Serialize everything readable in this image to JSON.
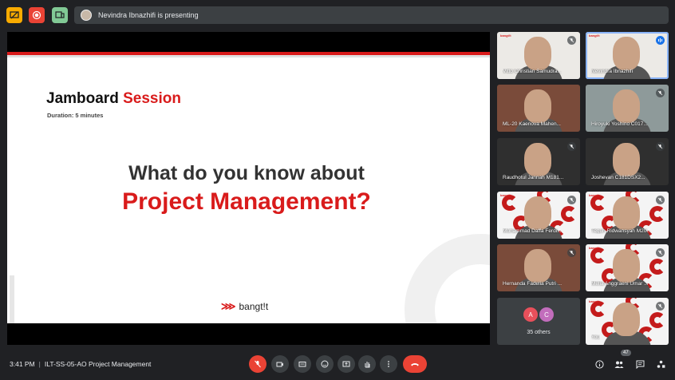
{
  "colors": {
    "bg": "#202124",
    "brand_red": "#d91b1b",
    "call_red": "#ea4335",
    "active_blue": "#1a73e8"
  },
  "topbar": {
    "presenting_text": "Nevindra Ibnazhifi is presenting",
    "icons": [
      "presentation-icon",
      "record-icon",
      "jamboard-icon"
    ]
  },
  "slide": {
    "title_black": "Jamboard",
    "title_red": "Session",
    "duration": "Duration: 5 minutes",
    "question_line1": "What do you know about",
    "question_line2": "Project Management?",
    "brand_mark": "⋙",
    "brand_text": "bangt!t"
  },
  "participants": [
    {
      "name": "Vitto Christian Samudra...",
      "muted": true,
      "bg": "white"
    },
    {
      "name": "Nevindra Ibnazhifi",
      "muted": false,
      "speaking": true,
      "bg": "white"
    },
    {
      "name": "ML-20 Kaenova Mahen...",
      "muted": false,
      "bg": "warm"
    },
    {
      "name": "Hiroyuki Yoshino C017...",
      "muted": true,
      "bg": "grey"
    },
    {
      "name": "Raudhotul Jannah M181...",
      "muted": true,
      "bg": "dark"
    },
    {
      "name": "Joshevan C181DSX2...",
      "muted": true,
      "bg": "dark"
    },
    {
      "name": "Muhammad Daffa Ferdi...",
      "muted": true,
      "bg": "pattern"
    },
    {
      "name": "Teguh Ridwansyah M20...",
      "muted": true,
      "bg": "pattern"
    },
    {
      "name": "Hernanda Fadelia Putri ...",
      "muted": true,
      "bg": "warm"
    },
    {
      "name": "Melia Anggraeni Umar ...",
      "muted": true,
      "bg": "pattern"
    },
    {
      "name": "You",
      "muted": true,
      "bg": "pattern"
    }
  ],
  "others": {
    "avatars": [
      "A",
      "C"
    ],
    "label": "35 others"
  },
  "bottombar": {
    "time": "3:41 PM",
    "separator": "|",
    "meeting_title": "ILT-SS-05-AO Project Management",
    "people_count": "47",
    "controls": [
      "mic-off-icon",
      "camera-icon",
      "captions-icon",
      "emoji-icon",
      "present-icon",
      "raise-hand-icon",
      "more-icon",
      "end-call-icon"
    ],
    "right_icons": [
      "info-icon",
      "people-icon",
      "chat-icon",
      "activities-icon"
    ]
  }
}
